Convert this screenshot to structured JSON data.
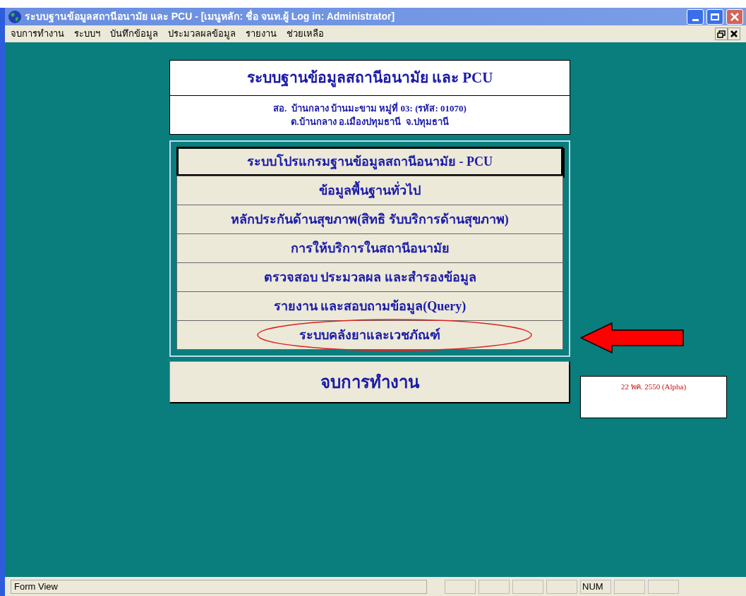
{
  "window": {
    "title": "ระบบฐานข้อมูลสถานีอนามัย และ PCU - [เมนูหลัก: ชื่อ จนท.ผู้ Log in: Administrator]"
  },
  "menu_bar": [
    "จบการทำงาน",
    "ระบบฯ",
    "บันทึกข้อมูล",
    "ประมวลผลข้อมูล",
    "รายงาน",
    "ช่วยเหลือ"
  ],
  "header": {
    "title": "ระบบฐานข้อมูลสถานีอนามัย และ PCU",
    "address_lines": [
      "สอ.  บ้านกลาง บ้านมะขาม หมู่ที่ 03: (รหัส: 01070)",
      "ต.บ้านกลาง อ.เมืองปทุมธานี  จ.ปทุมธานี"
    ]
  },
  "menu_items": [
    {
      "label": "ระบบโปรแกรมฐานข้อมูลสถานีอนามัย - PCU",
      "selected": true,
      "circled": false
    },
    {
      "label": "ข้อมูลพื้นฐานทั่วไป",
      "selected": false,
      "circled": false
    },
    {
      "label": "หลักประกันด้านสุขภาพ(สิทธิ รับบริการด้านสุขภาพ)",
      "selected": false,
      "circled": false
    },
    {
      "label": "การให้บริการในสถานีอนามัย",
      "selected": false,
      "circled": false
    },
    {
      "label": "ตรวจสอบ ประมวลผล และสำรองข้อมูล",
      "selected": false,
      "circled": false
    },
    {
      "label": "รายงาน และสอบถามข้อมูล(Query)",
      "selected": false,
      "circled": false
    },
    {
      "label": "ระบบคลังยาและเวชภัณฑ์",
      "selected": false,
      "circled": true
    }
  ],
  "exit_button": "จบการทำงาน",
  "version": "22 พค. 2550 (Alpha)",
  "status_bar": {
    "mode": "Form View",
    "indicators": [
      "NUM"
    ]
  }
}
